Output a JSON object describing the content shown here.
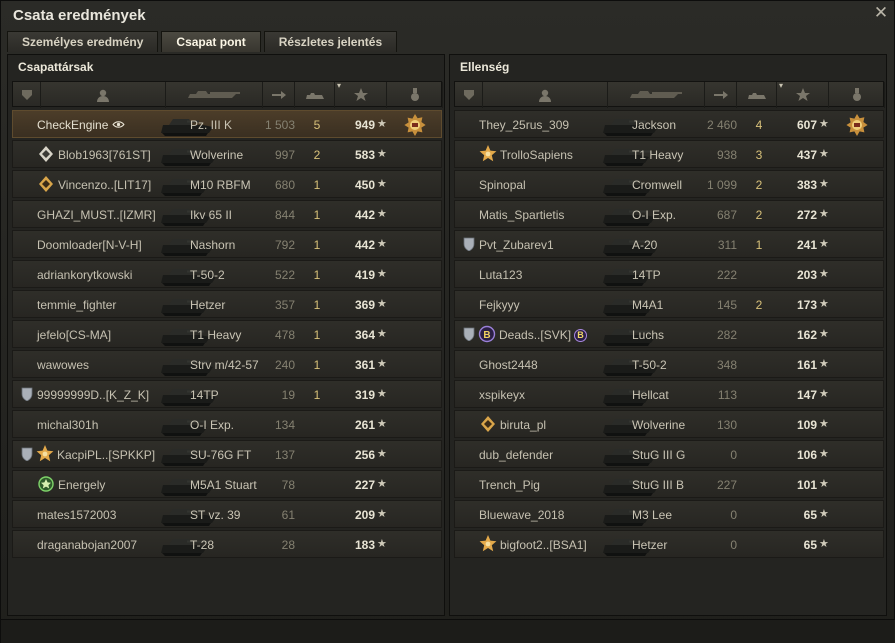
{
  "window": {
    "title": "Csata eredmények",
    "close_glyph": "✕"
  },
  "tabs": [
    {
      "label": "Személyes eredmény",
      "active": false
    },
    {
      "label": "Csapat pont",
      "active": true
    },
    {
      "label": "Részletes jelentés",
      "active": false
    }
  ],
  "teams": {
    "allies": {
      "title": "Csapattársak",
      "rows": [
        {
          "player": "CheckEngine",
          "tank": "Pz. III K",
          "damage": "1 503",
          "kills": "5",
          "xp": "949",
          "self": true,
          "badge": "",
          "rank": "",
          "medal": true
        },
        {
          "player": "Blob1963[761ST]",
          "tank": "Wolverine",
          "damage": "997",
          "kills": "2",
          "xp": "583",
          "badge": "",
          "rank": "diamond"
        },
        {
          "player": "Vincenzo..[LIT17]",
          "tank": "M10 RBFM",
          "damage": "680",
          "kills": "1",
          "xp": "450",
          "badge": "",
          "rank": "diamond-gold"
        },
        {
          "player": "GHAZI_MUST..[IZMR]",
          "tank": "Ikv 65 II",
          "damage": "844",
          "kills": "1",
          "xp": "442",
          "badge": "",
          "rank": ""
        },
        {
          "player": "Doomloader[N-V-H]",
          "tank": "Nashorn",
          "damage": "792",
          "kills": "1",
          "xp": "442",
          "badge": "",
          "rank": ""
        },
        {
          "player": "adriankorytkowski",
          "tank": "T-50-2",
          "damage": "522",
          "kills": "1",
          "xp": "419",
          "badge": "",
          "rank": ""
        },
        {
          "player": "temmie_fighter",
          "tank": "Hetzer",
          "damage": "357",
          "kills": "1",
          "xp": "369",
          "badge": "",
          "rank": ""
        },
        {
          "player": "jefelo[CS-MA]",
          "tank": "T1 Heavy",
          "damage": "478",
          "kills": "1",
          "xp": "364",
          "badge": "",
          "rank": ""
        },
        {
          "player": "wawowes",
          "tank": "Strv m/42-57",
          "damage": "240",
          "kills": "1",
          "xp": "361",
          "badge": "",
          "rank": ""
        },
        {
          "player": "99999999D..[K_Z_K]",
          "tank": "14TP",
          "damage": "19",
          "kills": "1",
          "xp": "319",
          "badge": "shield",
          "rank": ""
        },
        {
          "player": "michal301h",
          "tank": "O-I Exp.",
          "damage": "134",
          "kills": "",
          "xp": "261",
          "badge": "",
          "rank": ""
        },
        {
          "player": "KacpiPL..[SPKKP]",
          "tank": "SU-76G FT",
          "damage": "137",
          "kills": "",
          "xp": "256",
          "badge": "shield",
          "rank": "star-gold"
        },
        {
          "player": "Energely",
          "tank": "M5A1 Stuart",
          "damage": "78",
          "kills": "",
          "xp": "227",
          "badge": "",
          "rank": "green"
        },
        {
          "player": "mates1572003",
          "tank": "ST vz. 39",
          "damage": "61",
          "kills": "",
          "xp": "209",
          "badge": "",
          "rank": ""
        },
        {
          "player": "draganabojan2007",
          "tank": "T-28",
          "damage": "28",
          "kills": "",
          "xp": "183",
          "badge": "",
          "rank": ""
        }
      ]
    },
    "enemies": {
      "title": "Ellenség",
      "rows": [
        {
          "player": "They_25rus_309",
          "tank": "Jackson",
          "damage": "2 460",
          "kills": "4",
          "xp": "607",
          "badge": "",
          "rank": "",
          "medal": true
        },
        {
          "player": "TrolloSapiens",
          "tank": "T1 Heavy",
          "damage": "938",
          "kills": "3",
          "xp": "437",
          "badge": "",
          "rank": "star-gold"
        },
        {
          "player": "Spinopal",
          "tank": "Cromwell",
          "damage": "1 099",
          "kills": "2",
          "xp": "383",
          "badge": "",
          "rank": ""
        },
        {
          "player": "Matis_Spartietis",
          "tank": "O-I Exp.",
          "damage": "687",
          "kills": "2",
          "xp": "272",
          "badge": "",
          "rank": ""
        },
        {
          "player": "Pvt_Zubarev1",
          "tank": "A-20",
          "damage": "311",
          "kills": "1",
          "xp": "241",
          "badge": "shield",
          "rank": ""
        },
        {
          "player": "Luta123",
          "tank": "14TP",
          "damage": "222",
          "kills": "",
          "xp": "203",
          "badge": "",
          "rank": ""
        },
        {
          "player": "Fejkyyy",
          "tank": "M4A1",
          "damage": "145",
          "kills": "2",
          "xp": "173",
          "badge": "",
          "rank": ""
        },
        {
          "player": "Deads..[SVK]",
          "tank": "Luchs",
          "damage": "282",
          "kills": "",
          "xp": "162",
          "badge": "shield",
          "rank": "b-purple",
          "clan_badge": "B"
        },
        {
          "player": "Ghost2448",
          "tank": "T-50-2",
          "damage": "348",
          "kills": "",
          "xp": "161",
          "badge": "",
          "rank": ""
        },
        {
          "player": "xspikeyx",
          "tank": "Hellcat",
          "damage": "113",
          "kills": "",
          "xp": "147",
          "badge": "",
          "rank": ""
        },
        {
          "player": "biruta_pl",
          "tank": "Wolverine",
          "damage": "130",
          "kills": "",
          "xp": "109",
          "badge": "",
          "rank": "diamond-gold"
        },
        {
          "player": "dub_defender",
          "tank": "StuG III G",
          "damage": "0",
          "kills": "",
          "xp": "106",
          "badge": "",
          "rank": ""
        },
        {
          "player": "Trench_Pig",
          "tank": "StuG III B",
          "damage": "227",
          "kills": "",
          "xp": "101",
          "badge": "",
          "rank": ""
        },
        {
          "player": "Bluewave_2018",
          "tank": "M3 Lee",
          "damage": "0",
          "kills": "",
          "xp": "65",
          "badge": "",
          "rank": ""
        },
        {
          "player": "bigfoot2..[BSA1]",
          "tank": "Hetzer",
          "damage": "0",
          "kills": "",
          "xp": "65",
          "badge": "",
          "rank": "star-gold"
        }
      ]
    }
  },
  "colors": {
    "self_row": "#4c3d29",
    "xp": "#e8e4d4",
    "kills": "#d8c17a"
  }
}
